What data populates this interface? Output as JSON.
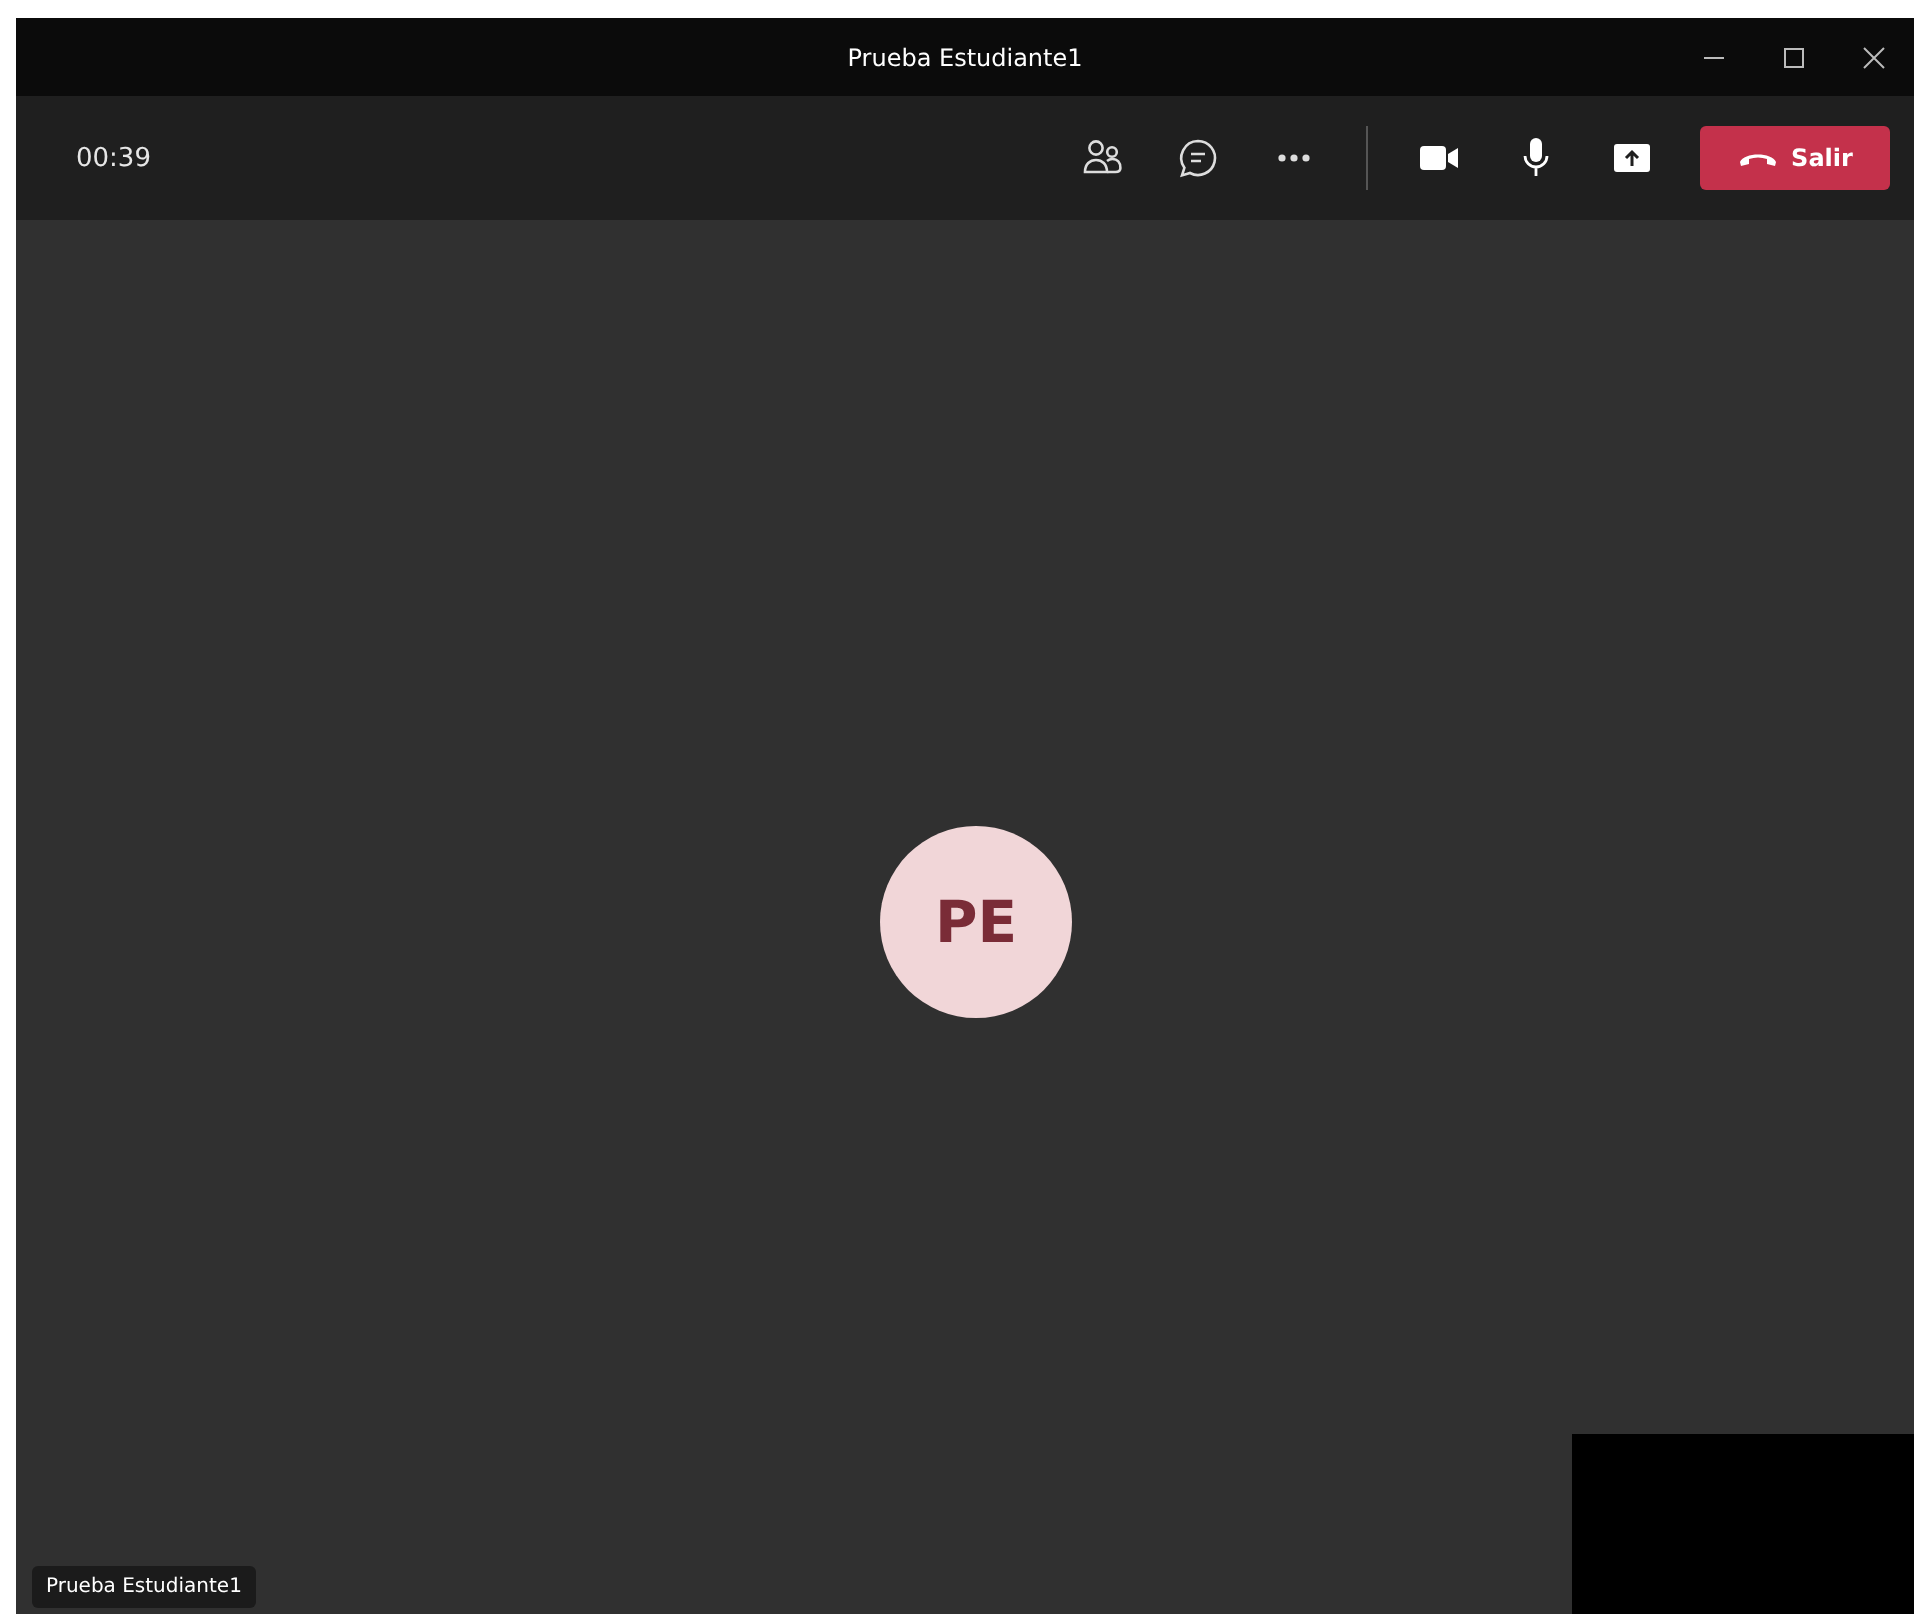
{
  "window": {
    "title": "Prueba Estudiante1"
  },
  "toolbar": {
    "timer": "00:39",
    "leave_button": "Salir"
  },
  "stage": {
    "avatar_initials": "PE",
    "name_tag": "Prueba Estudiante1",
    "self_view": {
      "kind": "camera-off"
    }
  }
}
